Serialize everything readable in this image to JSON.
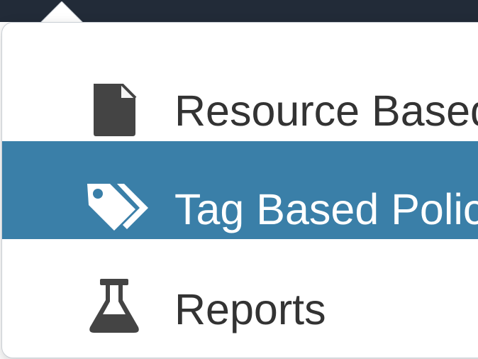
{
  "menu": {
    "items": [
      {
        "label": "Resource Based Policies",
        "icon": "document-icon"
      },
      {
        "label": "Tag Based Policies",
        "icon": "tags-icon"
      },
      {
        "label": "Reports",
        "icon": "flask-icon"
      }
    ],
    "active_item": "Tag Based Policies"
  },
  "colors": {
    "topbar": "#222b38",
    "active_item_background": "#3a7fa8",
    "default_text": "#333333",
    "active_text": "#ffffff"
  }
}
